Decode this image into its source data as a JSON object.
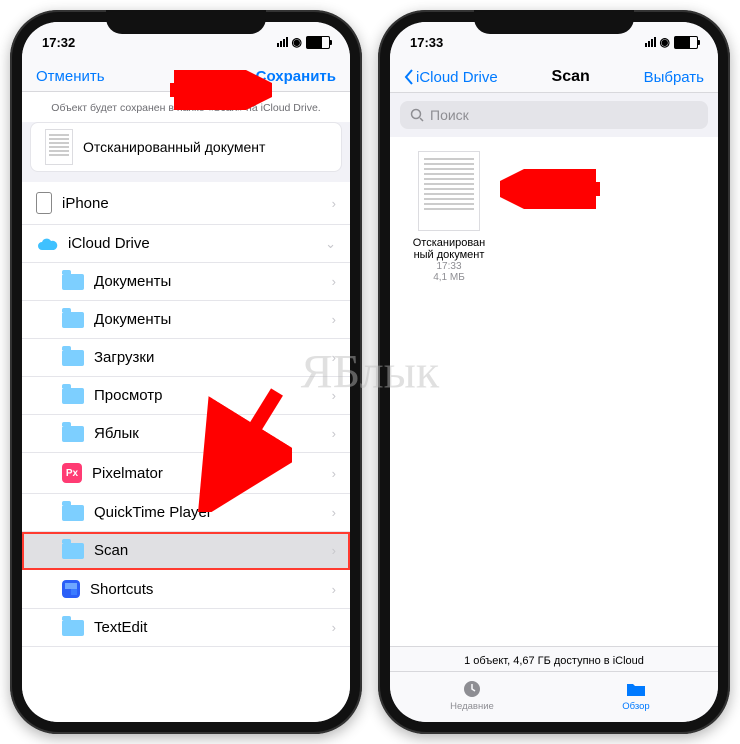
{
  "watermark": "ЯБлык",
  "left": {
    "time": "17:32",
    "cancel": "Отменить",
    "save": "Сохранить",
    "hint": "Объект будет сохранен в папке «Scan» на iCloud Drive.",
    "doc_name": "Отсканированный документ",
    "rows": [
      {
        "label": "iPhone",
        "type": "iphone",
        "child": false,
        "chev": "›"
      },
      {
        "label": "iCloud Drive",
        "type": "icloud",
        "child": false,
        "chev": "⌄"
      },
      {
        "label": "Документы",
        "type": "folder",
        "child": true,
        "chev": "›"
      },
      {
        "label": "Документы",
        "type": "folder",
        "child": true,
        "chev": "›"
      },
      {
        "label": "Загрузки",
        "type": "folder",
        "child": true,
        "chev": "›"
      },
      {
        "label": "Просмотр",
        "type": "folder",
        "child": true,
        "chev": "›"
      },
      {
        "label": "Яблык",
        "type": "folder",
        "child": true,
        "chev": "›"
      },
      {
        "label": "Pixelmator",
        "type": "pix",
        "child": true,
        "chev": "›"
      },
      {
        "label": "QuickTime Player",
        "type": "folder",
        "child": true,
        "chev": "›"
      },
      {
        "label": "Scan",
        "type": "folder",
        "child": true,
        "chev": "›",
        "selected": true
      },
      {
        "label": "Shortcuts",
        "type": "short",
        "child": true,
        "chev": "›"
      },
      {
        "label": "TextEdit",
        "type": "folder",
        "child": true,
        "chev": "›"
      }
    ]
  },
  "right": {
    "time": "17:33",
    "back": "iCloud Drive",
    "title": "Scan",
    "select": "Выбрать",
    "search_ph": "Поиск",
    "file": {
      "name": "Отсканирован\nный документ",
      "time": "17:33",
      "size": "4,1 МБ"
    },
    "footer": "1 объект, 4,67 ГБ доступно в iCloud",
    "tabs": {
      "recent": "Недавние",
      "browse": "Обзор"
    }
  }
}
